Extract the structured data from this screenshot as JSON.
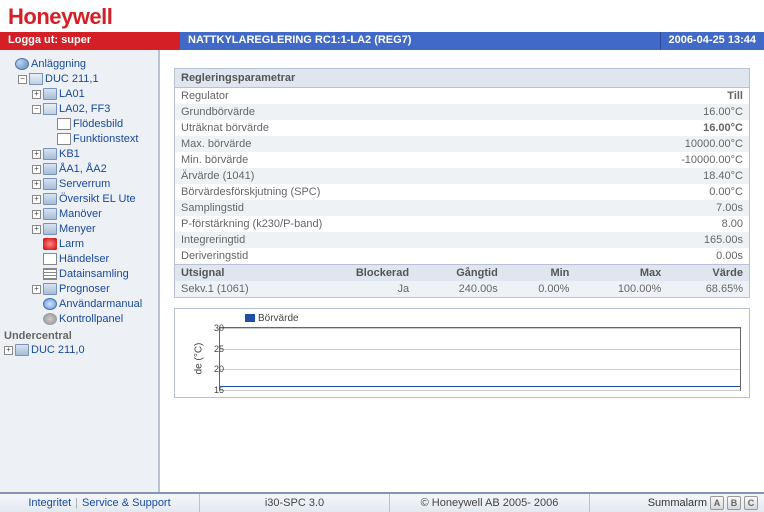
{
  "brand": "Honeywell",
  "topbar": {
    "logout_label": "Logga ut:",
    "user": "super",
    "title": "NATTKYLAREGLERING RC1:1-LA2 (REG7)",
    "datetime": "2006-04-25 13:44"
  },
  "tree": {
    "root": {
      "label": "Anläggning",
      "icon": "globe"
    },
    "items": [
      {
        "label": "DUC 211,1",
        "icon": "folder-o",
        "expanded": true,
        "children": [
          {
            "label": "LA01",
            "icon": "folder"
          },
          {
            "label": "LA02, FF3",
            "icon": "folder-o",
            "expanded": true,
            "children": [
              {
                "label": "Flödesbild",
                "icon": "doc"
              },
              {
                "label": "Funktionstext",
                "icon": "doc"
              }
            ]
          },
          {
            "label": "KB1",
            "icon": "folder"
          },
          {
            "label": "ÅA1, ÅA2",
            "icon": "folder"
          },
          {
            "label": "Serverrum",
            "icon": "folder"
          },
          {
            "label": "Översikt EL Ute",
            "icon": "folder"
          },
          {
            "label": "Manöver",
            "icon": "folder"
          },
          {
            "label": "Menyer",
            "icon": "folder"
          },
          {
            "label": "Larm",
            "icon": "alarm"
          },
          {
            "label": "Händelser",
            "icon": "doc"
          },
          {
            "label": "Datainsamling",
            "icon": "grid"
          },
          {
            "label": "Prognoser",
            "icon": "folder"
          },
          {
            "label": "Användarmanual",
            "icon": "help"
          },
          {
            "label": "Kontrollpanel",
            "icon": "gear"
          }
        ]
      }
    ],
    "section2_label": "Undercentral",
    "section2_item": {
      "label": "DUC 211,0",
      "icon": "folder"
    }
  },
  "panel": {
    "heading": "Regleringsparametrar",
    "rows": [
      {
        "label": "Regulator",
        "value": "Till",
        "cls": "v-blue"
      },
      {
        "label": "Grundbörvärde",
        "value": "16.00°C"
      },
      {
        "label": "Uträknat börvärde",
        "value": "16.00°C",
        "cls": "v-blue"
      },
      {
        "label": "Max. börvärde",
        "value": "10000.00°C"
      },
      {
        "label": "Min. börvärde",
        "value": "-10000.00°C"
      },
      {
        "label": "Ärvärde (1041)",
        "value": "18.40°C"
      },
      {
        "label": "Börvärdesförskjutning (SPC)",
        "value": "0.00°C"
      },
      {
        "label": "Samplingstid",
        "value": "7.00s"
      },
      {
        "label": "P-förstärkning (k230/P-band)",
        "value": "8.00"
      },
      {
        "label": "Integreringtid",
        "value": "165.00s"
      },
      {
        "label": "Deriveringstid",
        "value": "0.00s"
      }
    ],
    "subhead": [
      "Utsignal",
      "Blockerad",
      "Gångtid",
      "Min",
      "Max",
      "Värde"
    ],
    "subrow": [
      "Sekv.1 (1061)",
      "Ja",
      "240.00s",
      "0.00%",
      "100.00%",
      "68.65%"
    ]
  },
  "chart_data": {
    "type": "line",
    "title": "",
    "legend": [
      "Börvärde"
    ],
    "ylabel": "de (°C)",
    "yticks": [
      15,
      20,
      25,
      30
    ],
    "ylim": [
      15,
      30
    ],
    "series": [
      {
        "name": "Börvärde",
        "value_constant": 16.0
      }
    ]
  },
  "footer": {
    "link1": "Integritet",
    "link2": "Service & Support",
    "product": "i30-SPC 3.0",
    "copyright": "© Honeywell AB 2005- 2006",
    "alarm_label": "Summalarm",
    "badges": [
      "A",
      "B",
      "C"
    ]
  }
}
